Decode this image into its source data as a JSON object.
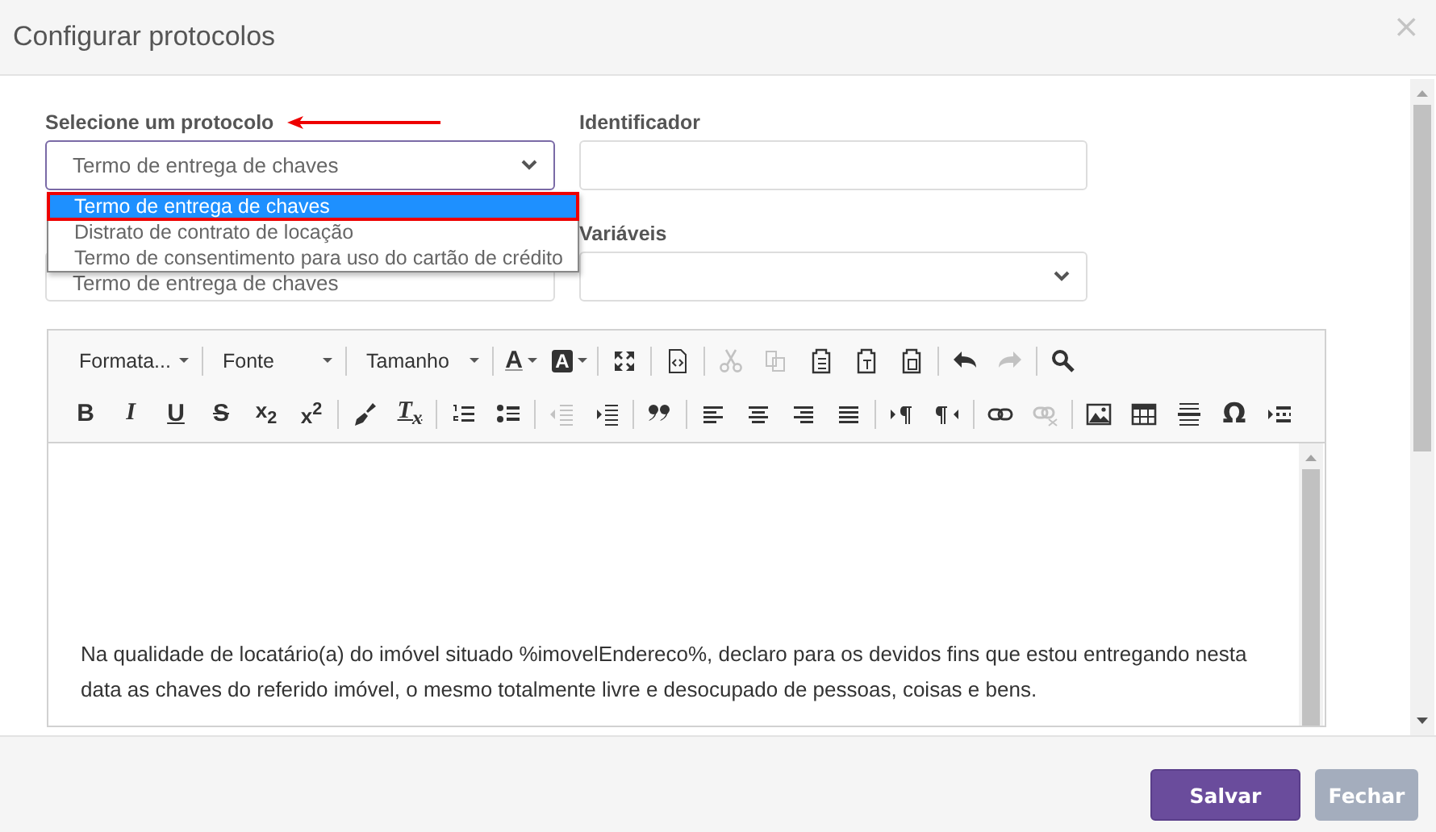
{
  "dialog": {
    "title": "Configurar protocolos",
    "close": "×"
  },
  "protocol": {
    "label": "Selecione um protocolo",
    "pointer_arrow": true,
    "value": "Termo de entrega de chaves",
    "expanded": true,
    "options": [
      {
        "label": "Termo de entrega de chaves",
        "selected": true,
        "outlined": true
      },
      {
        "label": "Distrato de contrato de locação",
        "selected": false,
        "outlined": false
      },
      {
        "label": "Termo de consentimento para uso do cartão de crédito",
        "selected": false,
        "outlined": false
      }
    ]
  },
  "identifier": {
    "label": "Identificador"
  },
  "field_3": {
    "value": "Termo de entrega de chaves"
  },
  "variables": {
    "label": "Variáveis"
  },
  "editor": {
    "toolbar_rows": [
      [
        [
          {
            "kind": "combo",
            "label": "Formata...",
            "disabled": false
          }
        ],
        [
          {
            "kind": "combo",
            "label": "Fonte",
            "disabled": false
          }
        ],
        [
          {
            "kind": "combo",
            "label": "Tamanho",
            "disabled": false
          }
        ],
        [
          {
            "kind": "textcolor",
            "label": "A",
            "disabled": false
          },
          {
            "kind": "bgcolor",
            "label": "A",
            "disabled": false
          }
        ],
        [
          {
            "kind": "maximize",
            "disabled": false
          }
        ],
        [
          {
            "kind": "source",
            "disabled": false
          }
        ],
        [
          {
            "kind": "cut",
            "disabled": true
          },
          {
            "kind": "copy",
            "disabled": true
          },
          {
            "kind": "paste",
            "disabled": false
          },
          {
            "kind": "pastetext",
            "disabled": false
          },
          {
            "kind": "pasteword",
            "disabled": false
          }
        ],
        [
          {
            "kind": "undo",
            "disabled": false
          },
          {
            "kind": "redo",
            "disabled": true
          }
        ],
        [
          {
            "kind": "find",
            "disabled": false
          }
        ]
      ],
      [
        [
          {
            "kind": "bold",
            "label": "B",
            "disabled": false
          },
          {
            "kind": "italic",
            "label": "I",
            "disabled": false
          },
          {
            "kind": "underline",
            "label": "U",
            "disabled": false
          },
          {
            "kind": "strike",
            "label": "S",
            "disabled": false
          },
          {
            "kind": "script",
            "label": "x$_{2}$",
            "disabled": false
          },
          {
            "kind": "script",
            "label": "x$^{2}$",
            "disabled": false
          }
        ],
        [
          {
            "kind": "brush",
            "disabled": false
          },
          {
            "kind": "removeformat",
            "label": "T$_{x}$",
            "disabled": false
          }
        ],
        [
          {
            "kind": "numlist",
            "disabled": false
          },
          {
            "kind": "bullist",
            "disabled": false
          }
        ],
        [
          {
            "kind": "outdent",
            "disabled": true
          },
          {
            "kind": "indent",
            "disabled": false
          }
        ],
        [
          {
            "kind": "quote",
            "disabled": false
          }
        ],
        [
          {
            "kind": "alignleft",
            "disabled": false
          },
          {
            "kind": "aligncenter",
            "disabled": false
          },
          {
            "kind": "alignright",
            "disabled": false
          },
          {
            "kind": "justify",
            "disabled": false
          }
        ],
        [
          {
            "kind": "ltr",
            "disabled": false
          },
          {
            "kind": "rtl",
            "disabled": false
          }
        ],
        [
          {
            "kind": "link",
            "disabled": false
          },
          {
            "kind": "unlink",
            "disabled": true
          }
        ],
        [
          {
            "kind": "image",
            "disabled": false
          },
          {
            "kind": "table",
            "disabled": false
          },
          {
            "kind": "hr",
            "disabled": false
          },
          {
            "kind": "special",
            "label": "Ω",
            "disabled": false
          },
          {
            "kind": "pagebreak",
            "disabled": false
          }
        ]
      ]
    ],
    "content": [
      "Na qualidade de locatário(a) do imóvel situado %imovelEndereco%, declaro para os devidos fins que estou entregando nesta data as chaves do referido imóvel, o mesmo totalmente livre e desocupado de pessoas, coisas e bens."
    ]
  },
  "buttons": [
    {
      "label": "Salvar",
      "kind": "primary",
      "disabled": false
    },
    {
      "label": "Fechar",
      "kind": "secondary",
      "disabled": true
    }
  ]
}
